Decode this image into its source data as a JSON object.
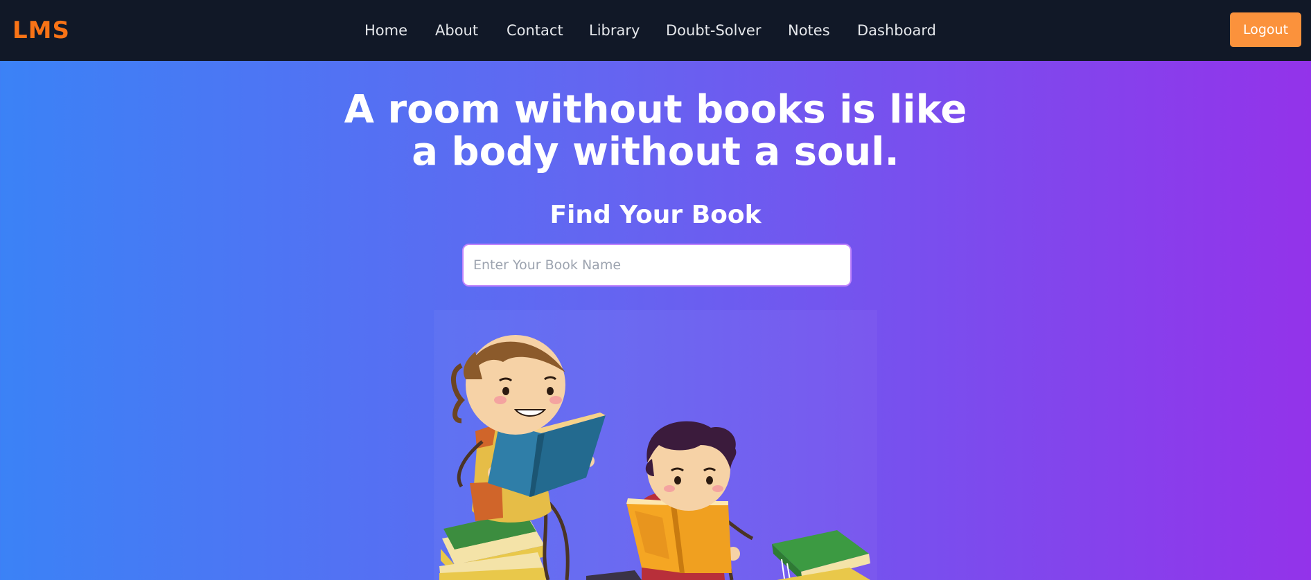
{
  "navbar": {
    "logo": "LMS",
    "links": [
      {
        "label": "Home"
      },
      {
        "label": "About"
      },
      {
        "label": "Contact"
      },
      {
        "label": "Library"
      },
      {
        "label": "Doubt-Solver"
      },
      {
        "label": "Notes"
      },
      {
        "label": "Dashboard"
      }
    ],
    "logout_label": "Logout"
  },
  "hero": {
    "title_line1": "A room without books is like",
    "title_line2": "a body without a soul.",
    "find_title": "Find Your Book",
    "search_placeholder": "Enter Your Book Name"
  },
  "illustration": {
    "icon": "kids-reading-books-illustration"
  },
  "colors": {
    "nav_bg": "#111827",
    "logo": "#f97316",
    "logout_bg": "#fb923c",
    "gradient_start": "#3b82f6",
    "gradient_end": "#9333ea"
  }
}
